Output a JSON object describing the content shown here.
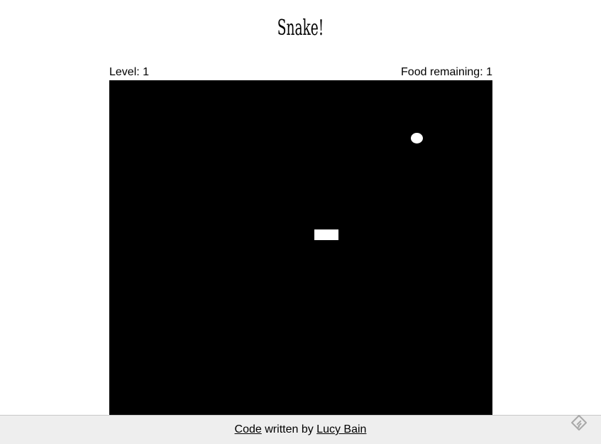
{
  "page": {
    "title": "Snake!"
  },
  "stats": {
    "level_text": "Level: 1",
    "food_text": "Food remaining: 1"
  },
  "game": {
    "board_color": "#000000",
    "piece_color": "#ffffff"
  },
  "footer": {
    "code_link": "Code",
    "middle_text": "written by",
    "author_link": "Lucy Bain",
    "background": "#eeeeee"
  },
  "icons": {
    "corner": "feedly-icon"
  }
}
